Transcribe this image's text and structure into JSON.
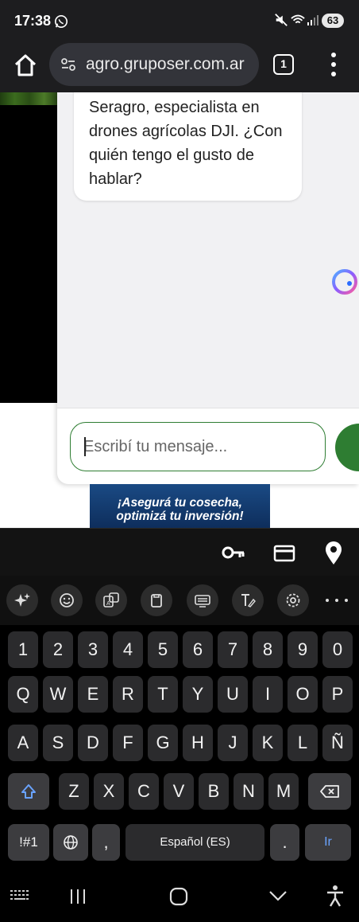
{
  "status_bar": {
    "time": "17:38",
    "battery": "63"
  },
  "browser": {
    "url": "agro.gruposer.com.ar",
    "tab_count": "1"
  },
  "chat": {
    "bot_message": "Seragro, especialista en drones agrícolas DJI. ¿Con quién tengo el gusto de hablar?",
    "input_placeholder": "Escribí tu mensaje...",
    "input_value": ""
  },
  "banner": {
    "line1": "¡Asegurá tu cosecha,",
    "line2": "optimizá tu inversión!"
  },
  "keyboard": {
    "number_row": [
      "1",
      "2",
      "3",
      "4",
      "5",
      "6",
      "7",
      "8",
      "9",
      "0"
    ],
    "row1": [
      "Q",
      "W",
      "E",
      "R",
      "T",
      "Y",
      "U",
      "I",
      "O",
      "P"
    ],
    "row2": [
      "A",
      "S",
      "D",
      "F",
      "G",
      "H",
      "J",
      "K",
      "L",
      "Ñ"
    ],
    "row3": [
      "Z",
      "X",
      "C",
      "V",
      "B",
      "N",
      "M"
    ],
    "symbols_label": "!#1",
    "comma_label": ",",
    "space_label": "Español (ES)",
    "period_label": ".",
    "go_label": "Ir"
  },
  "colors": {
    "accent_green": "#2e7d32",
    "go_blue": "#6aa3ff",
    "banner_blue": "#1a4a84"
  }
}
